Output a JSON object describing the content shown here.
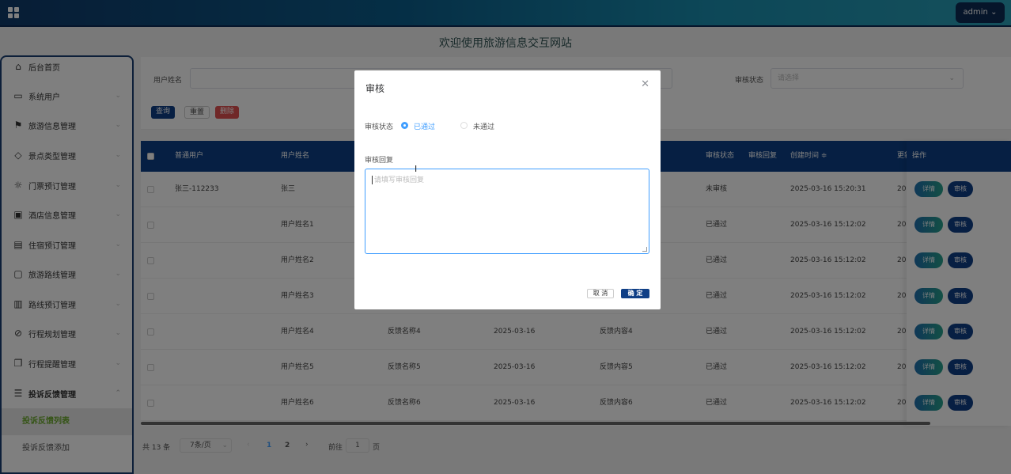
{
  "header": {
    "admin_label": "admin",
    "site_title": "欢迎使用旅游信息交互网站"
  },
  "sidebar": {
    "items": [
      {
        "label": "后台首页"
      },
      {
        "label": "系统用户"
      },
      {
        "label": "旅游信息管理"
      },
      {
        "label": "景点类型管理"
      },
      {
        "label": "门票预订管理"
      },
      {
        "label": "酒店信息管理"
      },
      {
        "label": "住宿预订管理"
      },
      {
        "label": "旅游路线管理"
      },
      {
        "label": "路线预订管理"
      },
      {
        "label": "行程规划管理"
      },
      {
        "label": "行程提醒管理"
      },
      {
        "label": "投诉反馈管理"
      }
    ],
    "subitems": [
      {
        "label": "投诉反馈列表"
      },
      {
        "label": "投诉反馈添加"
      }
    ]
  },
  "search": {
    "user_name_label": "用户姓名",
    "audit_status_label": "审核状态",
    "audit_status_placeholder": "请选择",
    "query_btn": "查询",
    "reset_btn": "重置",
    "delete_btn": "删除"
  },
  "table": {
    "headers": [
      "普通用户",
      "用户姓名",
      "审核状态",
      "审核回复",
      "创建时间 ≑",
      "更新",
      "操作"
    ],
    "rows": [
      {
        "user": "张三-112233",
        "name": "张三",
        "feedback": "",
        "date": "",
        "content": "",
        "status": "未审核",
        "created": "2025-03-16 15:20:31",
        "updated": "20"
      },
      {
        "user": "",
        "name": "用户姓名1",
        "feedback": "",
        "date": "",
        "content": "",
        "status": "已通过",
        "created": "2025-03-16 15:12:02",
        "updated": "20"
      },
      {
        "user": "",
        "name": "用户姓名2",
        "feedback": "",
        "date": "",
        "content": "",
        "status": "已通过",
        "created": "2025-03-16 15:12:02",
        "updated": "20"
      },
      {
        "user": "",
        "name": "用户姓名3",
        "feedback": "",
        "date": "",
        "content": "",
        "status": "已通过",
        "created": "2025-03-16 15:12:02",
        "updated": "20"
      },
      {
        "user": "",
        "name": "用户姓名4",
        "feedback": "反馈名称4",
        "date": "2025-03-16",
        "content": "反馈内容4",
        "status": "已通过",
        "created": "2025-03-16 15:12:02",
        "updated": "20"
      },
      {
        "user": "",
        "name": "用户姓名5",
        "feedback": "反馈名称5",
        "date": "2025-03-16",
        "content": "反馈内容5",
        "status": "已通过",
        "created": "2025-03-16 15:12:02",
        "updated": "20"
      },
      {
        "user": "",
        "name": "用户姓名6",
        "feedback": "反馈名称6",
        "date": "2025-03-16",
        "content": "反馈内容6",
        "status": "已通过",
        "created": "2025-03-16 15:12:02",
        "updated": "20"
      }
    ],
    "detail_btn": "详情",
    "audit_btn": "审核"
  },
  "pagination": {
    "total": "共 13 条",
    "page_size": "7条/页",
    "pages": [
      "1",
      "2"
    ],
    "goto_label": "前往",
    "goto_value": "1",
    "goto_suffix": "页"
  },
  "dialog": {
    "title": "审核",
    "status_label": "审核状态",
    "option_passed": "已通过",
    "option_failed": "未通过",
    "reply_label": "审核回复",
    "reply_placeholder": "请填写审核回复",
    "cancel_btn": "取 消",
    "confirm_btn": "确 定"
  }
}
